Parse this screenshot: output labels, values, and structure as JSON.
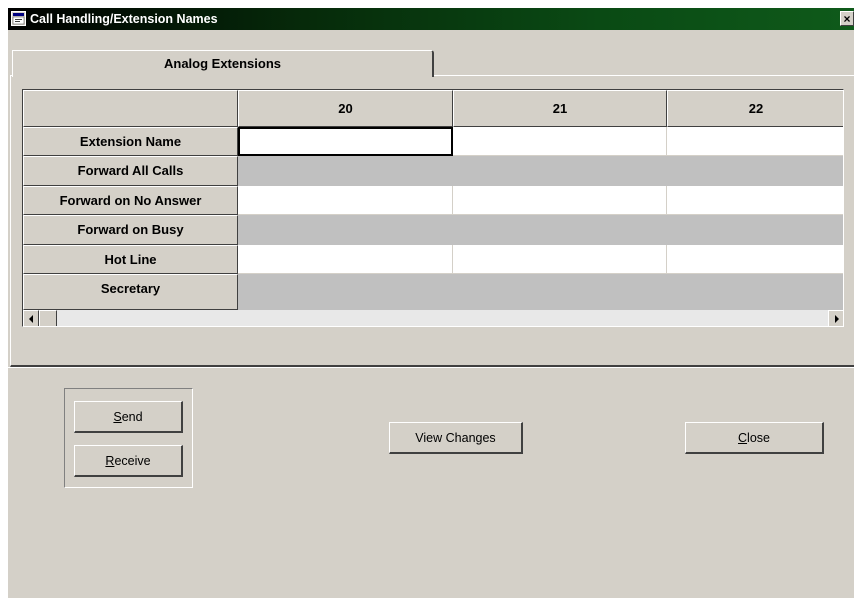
{
  "window": {
    "title": "Call Handling/Extension Names",
    "close_glyph": "×"
  },
  "tabs": [
    {
      "label": "Analog Extensions"
    }
  ],
  "grid": {
    "columns": [
      "20",
      "21",
      "22"
    ],
    "rows": [
      "Extension Name",
      "Forward All Calls",
      "Forward on No Answer",
      "Forward on Busy",
      "Hot Line",
      "Secretary"
    ]
  },
  "buttons": {
    "send": {
      "accel": "S",
      "rest": "end"
    },
    "receive": {
      "accel": "R",
      "rest": "eceive"
    },
    "view_changes": "View Changes",
    "close": {
      "accel": "C",
      "rest": "lose"
    }
  },
  "colors": {
    "face": "#d4d0c8",
    "shaded_row": "#c0c0c0",
    "title_start": "#000000",
    "title_end": "#0f5a1a"
  },
  "icons": {
    "app": "window-icon",
    "scroll_left": "left-arrow-icon",
    "scroll_right": "right-arrow-icon"
  }
}
